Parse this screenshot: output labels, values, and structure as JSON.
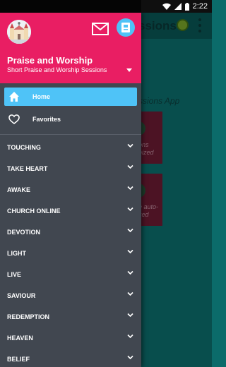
{
  "status_bar": {
    "time": "2:22",
    "icons": [
      "wifi-icon",
      "cell-signal-icon",
      "battery-icon"
    ]
  },
  "background_app": {
    "title_fragment": "ssions",
    "subtitle_fragment": "ssions App",
    "cards": [
      {
        "text_line1": "ons",
        "text_line2": "nized"
      },
      {
        "text_line1": "e auto-",
        "text_line2": "zed"
      }
    ]
  },
  "drawer": {
    "header": {
      "title": "Praise and Worship",
      "subtitle": "Short Praise and Worship Sessions",
      "logo_icon": "church-logo-icon",
      "mail_icon": "mail-icon",
      "profile_icon": "profile-icon"
    },
    "primary_items": [
      {
        "label": "Home",
        "icon": "home-icon",
        "active": true
      },
      {
        "label": "Favorites",
        "icon": "heart-outline-icon",
        "active": false
      }
    ],
    "categories": [
      {
        "label": "TOUCHING"
      },
      {
        "label": "TAKE HEART"
      },
      {
        "label": "AWAKE"
      },
      {
        "label": "CHURCH ONLINE"
      },
      {
        "label": "DEVOTION"
      },
      {
        "label": "LIGHT"
      },
      {
        "label": "LIVE"
      },
      {
        "label": "SAVIOUR"
      },
      {
        "label": "REDEMPTION"
      },
      {
        "label": "HEAVEN"
      },
      {
        "label": "BELIEF"
      }
    ]
  },
  "colors": {
    "header": "#e91e63",
    "drawer": "#414750",
    "active_item": "#4fc3f7",
    "app_background": "#0e7e7d"
  }
}
